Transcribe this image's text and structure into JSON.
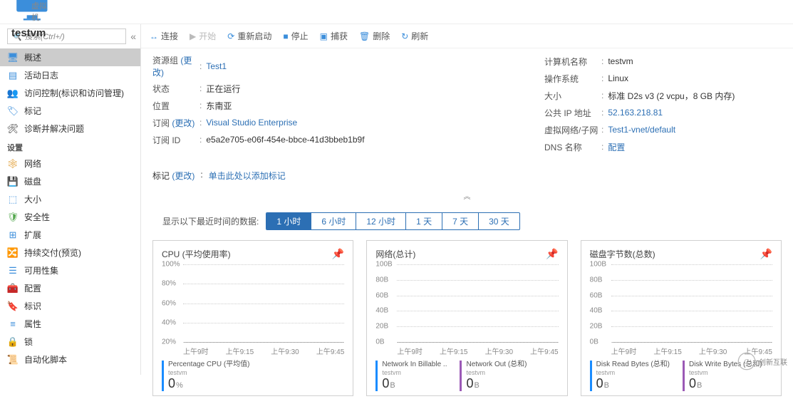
{
  "header": {
    "title": "testvm",
    "subtitle": "虚拟机"
  },
  "search_placeholder": "搜索(Ctrl+/)",
  "sidebar": {
    "items_top": [
      {
        "label": "概述",
        "icon": "monitor",
        "color": "#3b8edb"
      },
      {
        "label": "活动日志",
        "icon": "log",
        "color": "#3b8edb"
      },
      {
        "label": "访问控制(标识和访问管理)",
        "icon": "people",
        "color": "#3b8edb"
      },
      {
        "label": "标记",
        "icon": "tag",
        "color": "#3b8edb"
      },
      {
        "label": "诊断并解决问题",
        "icon": "wrench",
        "color": "#333"
      }
    ],
    "section_settings": "设置",
    "items_settings": [
      {
        "label": "网络",
        "icon": "network",
        "color": "#e2a13b"
      },
      {
        "label": "磁盘",
        "icon": "disks",
        "color": "#3b8edb"
      },
      {
        "label": "大小",
        "icon": "size",
        "color": "#3b8edb"
      },
      {
        "label": "安全性",
        "icon": "shield",
        "color": "#55a84f"
      },
      {
        "label": "扩展",
        "icon": "ext",
        "color": "#3b8edb"
      },
      {
        "label": "持续交付(预览)",
        "icon": "cd",
        "color": "#3b8edb"
      },
      {
        "label": "可用性集",
        "icon": "avail",
        "color": "#3b8edb"
      },
      {
        "label": "配置",
        "icon": "config",
        "color": "#c0392b"
      },
      {
        "label": "标识",
        "icon": "ident",
        "color": "#e2a13b"
      },
      {
        "label": "属性",
        "icon": "props",
        "color": "#3b8edb"
      },
      {
        "label": "锁",
        "icon": "lock",
        "color": "#555"
      },
      {
        "label": "自动化脚本",
        "icon": "script",
        "color": "#3b8edb"
      }
    ]
  },
  "toolbar": {
    "connect": "连接",
    "start": "开始",
    "restart": "重新启动",
    "stop": "停止",
    "capture": "捕获",
    "delete": "删除",
    "refresh": "刷新"
  },
  "props": {
    "left": {
      "resource_group_label": "资源组",
      "change": "(更改)",
      "resource_group_value": "Test1",
      "status_label": "状态",
      "status_value": "正在运行",
      "location_label": "位置",
      "location_value": "东南亚",
      "subscription_label": "订阅",
      "subscription_value": "Visual Studio Enterprise",
      "subscription_id_label": "订阅 ID",
      "subscription_id_value": "e5a2e705-e06f-454e-bbce-41d3bbeb1b9f"
    },
    "right": {
      "computer_name_label": "计算机名称",
      "computer_name_value": "testvm",
      "os_label": "操作系统",
      "os_value": "Linux",
      "size_label": "大小",
      "size_value": "标准 D2s v3 (2 vcpu，8 GB 内存)",
      "ip_label": "公共 IP 地址",
      "ip_value": "52.163.218.81",
      "vnet_label": "虚拟网络/子网",
      "vnet_value": "Test1-vnet/default",
      "dns_label": "DNS 名称",
      "dns_value": "配置"
    }
  },
  "tags": {
    "label": "标记",
    "change": "(更改)",
    "hint": "单击此处以添加标记"
  },
  "timebar": {
    "label": "显示以下最近时间的数据:",
    "tabs": [
      "1 小时",
      "6 小时",
      "12 小时",
      "1 天",
      "7 天",
      "30 天"
    ],
    "selected_index": 0
  },
  "chart_data": [
    {
      "type": "line",
      "title": "CPU (平均使用率)",
      "x": [
        "上午9时",
        "上午9:15",
        "上午9:30",
        "上午9:45"
      ],
      "y_ticks": [
        "100%",
        "80%",
        "60%",
        "40%",
        "20%"
      ],
      "ylim": [
        0,
        100
      ],
      "series": [
        {
          "name": "Percentage CPU (平均值)",
          "sub": "testvm",
          "value": "0",
          "unit": "%",
          "color": "c-blue",
          "values": [
            0,
            0,
            0,
            0
          ]
        }
      ]
    },
    {
      "type": "line",
      "title": "网络(总计)",
      "x": [
        "上午9时",
        "上午9:15",
        "上午9:30",
        "上午9:45"
      ],
      "y_ticks": [
        "100B",
        "80B",
        "60B",
        "40B",
        "20B",
        "0B"
      ],
      "ylim": [
        0,
        100
      ],
      "series": [
        {
          "name": "Network In Billable ..",
          "sub": "testvm",
          "value": "0",
          "unit": "B",
          "color": "c-blue",
          "values": [
            0,
            0,
            0,
            0
          ]
        },
        {
          "name": "Network Out (总和)",
          "sub": "testvm",
          "value": "0",
          "unit": "B",
          "color": "c-purple",
          "values": [
            0,
            0,
            0,
            0
          ]
        }
      ]
    },
    {
      "type": "line",
      "title": "磁盘字节数(总数)",
      "x": [
        "上午9时",
        "上午9:15",
        "上午9:30",
        "上午9:45"
      ],
      "y_ticks": [
        "100B",
        "80B",
        "60B",
        "40B",
        "20B",
        "0B"
      ],
      "ylim": [
        0,
        100
      ],
      "series": [
        {
          "name": "Disk Read Bytes (总和)",
          "sub": "testvm",
          "value": "0",
          "unit": "B",
          "color": "c-blue",
          "values": [
            0,
            0,
            0,
            0
          ]
        },
        {
          "name": "Disk Write Bytes (总和)",
          "sub": "testvm",
          "value": "0",
          "unit": "B",
          "color": "c-purple",
          "values": [
            0,
            0,
            0,
            0
          ]
        }
      ]
    }
  ],
  "footer_logo": "创新互联"
}
